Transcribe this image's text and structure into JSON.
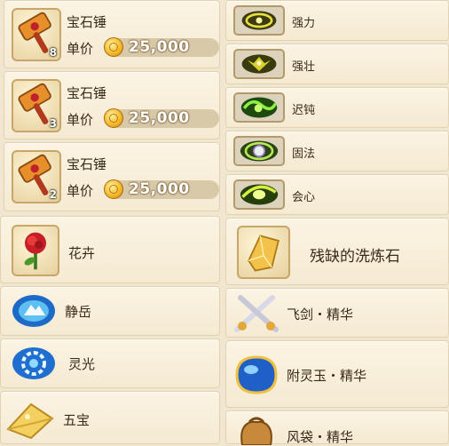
{
  "shop_items": [
    {
      "name": "宝石锤",
      "quantity": "8",
      "price_label": "单价",
      "price": "25,000"
    },
    {
      "name": "宝石锤",
      "quantity": "3",
      "price_label": "单价",
      "price": "25,000"
    },
    {
      "name": "宝石锤",
      "quantity": "2",
      "price_label": "单价",
      "price": "25,000"
    }
  ],
  "skills": [
    {
      "name": "强力",
      "icon": "strength-icon"
    },
    {
      "name": "强壮",
      "icon": "sturdy-icon"
    },
    {
      "name": "迟钝",
      "icon": "slow-icon"
    },
    {
      "name": "固法",
      "icon": "solid-magic-icon"
    },
    {
      "name": "会心",
      "icon": "critical-icon"
    }
  ],
  "materials_left": [
    {
      "name": "花卉",
      "icon": "flower-icon"
    },
    {
      "name": "静岳",
      "icon": "still-mountain-icon"
    },
    {
      "name": "灵光",
      "icon": "spirit-light-icon"
    },
    {
      "name": "五宝",
      "icon": "five-treasures-icon"
    }
  ],
  "materials_right": [
    {
      "name": "残缺的洗炼石",
      "icon": "refining-stone-icon"
    },
    {
      "name": "飞剑・精华",
      "icon": "flying-sword-icon"
    },
    {
      "name": "附灵玉・精华",
      "icon": "spirit-jade-icon"
    },
    {
      "name": "风袋・精华",
      "icon": "wind-bag-icon"
    }
  ],
  "colors": {
    "panel": "#fbf4e3",
    "border": "#e2d2b1",
    "text": "#3a2a17",
    "coin": "#f2b624"
  }
}
